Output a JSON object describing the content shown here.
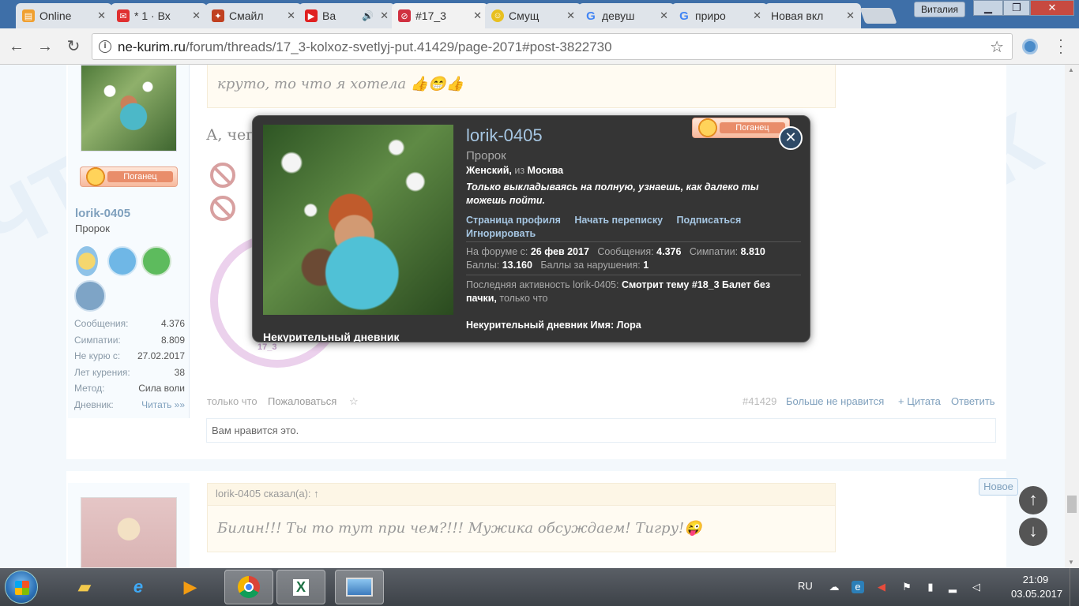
{
  "browser": {
    "tabs": [
      {
        "label": "Online",
        "icon_color": "#f0a030"
      },
      {
        "label": "* 1 · Вх",
        "icon_color": "#e03030"
      },
      {
        "label": "Смайл",
        "icon_color": "#c04020"
      },
      {
        "label": "Ва",
        "icon_color": "#e02020"
      },
      {
        "label": "#17_3",
        "icon_color": "#d03040"
      },
      {
        "label": "Смущ",
        "icon_color": "#e8c020"
      },
      {
        "label": "девуш",
        "icon_color": "#4285f4"
      },
      {
        "label": "приро",
        "icon_color": "#4285f4"
      },
      {
        "label": "Новая вкл",
        "icon_color": "#dddddd"
      }
    ],
    "user": "Виталия",
    "url_host": "ne-kurim.ru",
    "url_path": "/forum/threads/17_3-kolxoz-svetlyj-put.41429/page-2071#post-3822730"
  },
  "post": {
    "quote_text": "круто, то что я хотела 👍😁👍",
    "text": "А, чего ... убрали и усё?",
    "username": "lorik-0405",
    "user_title": "Пророк",
    "badge_label": "Поганец",
    "stats": [
      {
        "label": "Сообщения:",
        "value": "4.376"
      },
      {
        "label": "Симпатии:",
        "value": "8.809"
      },
      {
        "label": "Не курю с:",
        "value": "27.02.2017"
      },
      {
        "label": "Лет курения:",
        "value": "38"
      },
      {
        "label": "Метод:",
        "value": "Сила воли"
      },
      {
        "label": "Дневник:",
        "value": "Читать »»"
      }
    ],
    "stamp_text": "17_3",
    "meta_time": "только что",
    "meta_report": "Пожаловаться",
    "meta_star": "☆",
    "meta_num": "#41429",
    "meta_unlike": "Больше не нравится",
    "meta_quote": "+ Цитата",
    "meta_reply": "Ответить",
    "likes_text": "Вам нравится это."
  },
  "post2": {
    "quote_header": "lorik-0405 сказал(а): ↑",
    "quote_body": "Билин!!! Ты то тут при чем?!!! Мужика обсуждаем! Тигру!😜",
    "new_badge": "Новое"
  },
  "popup": {
    "name": "lorik-0405",
    "role": "Пророк",
    "gender": "Женский,",
    "from_label": "из",
    "city": "Москва",
    "status": "Только выкладываясь на полную, узнаешь, как далеко ты можешь пойти.",
    "links": [
      "Страница профиля",
      "Начать переписку",
      "Подписаться",
      "Игнорировать"
    ],
    "forum_since_label": "На форуме с:",
    "forum_since": "26 фев 2017",
    "messages_label": "Сообщения:",
    "messages": "4.376",
    "likes_label": "Симпатии:",
    "likes": "8.810",
    "points_label": "Баллы:",
    "points": "13.160",
    "violations_label": "Баллы за нарушения:",
    "violations": "1",
    "activity_label": "Последняя активность lorik-0405:",
    "activity": "Смотрит тему #18_3 Балет без пачки,",
    "activity_time": "только что",
    "diary": "Некурительный дневник Имя: Лора",
    "photo_caption": "Некурительный дневник",
    "badge_label": "Поганец"
  },
  "taskbar": {
    "lang": "RU",
    "time": "21:09",
    "date": "03.05.2017"
  }
}
